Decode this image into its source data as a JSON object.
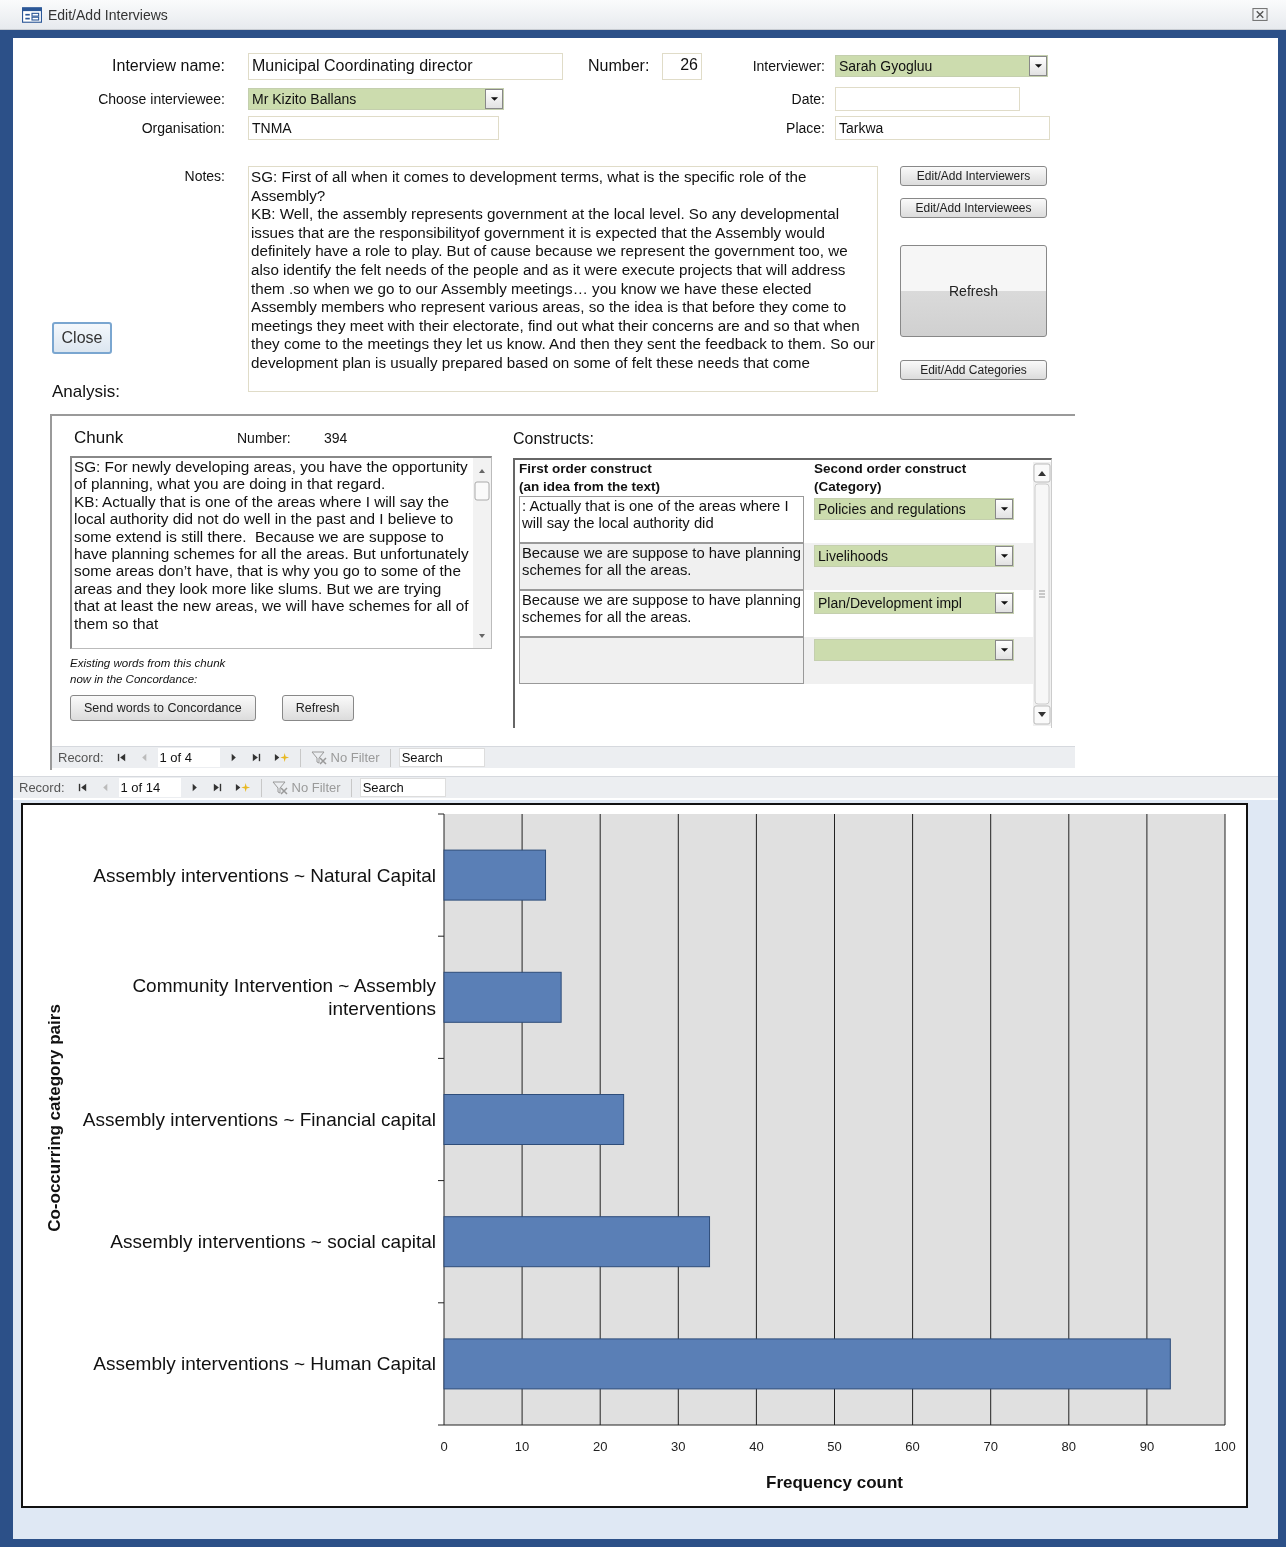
{
  "window": {
    "title": "Edit/Add Interviews"
  },
  "form": {
    "interview_name": {
      "label": "Interview name:",
      "value": "Municipal Coordinating director"
    },
    "number": {
      "label": "Number:",
      "value": "26"
    },
    "interviewer": {
      "label": "Interviewer:",
      "value": "Sarah Gyogluu"
    },
    "interviewee": {
      "label": "Choose interviewee:",
      "value": "Mr Kizito Ballans"
    },
    "date": {
      "label": "Date:"
    },
    "organisation": {
      "label": "Organisation:",
      "value": "TNMA"
    },
    "place": {
      "label": "Place:",
      "value": "Tarkwa"
    },
    "notes": {
      "label": "Notes:",
      "value": "SG: First of all when it comes to development terms, what is the specific role of the Assembly?\nKB: Well, the assembly represents government at the local level. So any developmental issues that are the responsibilityof government it is expected that the Assembly would definitely have a role to play. But of cause because we represent the government too, we also identify the felt needs of the people and as it were execute projects that will address them .so when we go to our Assembly meetings… you know we have these elected Assembly members who represent various areas, so the idea is that before they come to meetings they meet with their electorate, find out what their concerns are and so that when they come to the meetings they let us know. And then they sent the feedback to them. So our development plan is usually prepared based on some of felt these needs that come"
    }
  },
  "side_buttons": [
    {
      "label": "Edit/Add Interviewers",
      "kind": "small"
    },
    {
      "label": "Edit/Add Interviewees",
      "kind": "small"
    },
    {
      "label": "Refresh",
      "kind": "large"
    },
    {
      "label": "Edit/Add Categories",
      "kind": "small"
    }
  ],
  "close_button": "Close",
  "analysis": {
    "label": "Analysis:",
    "chunk": {
      "title": "Chunk",
      "number_label": "Number:",
      "number": "394",
      "text": "SG: For newly developing areas, you have the opportunity of planning, what you are doing in that regard.\nKB: Actually that is one of the areas where I will say the local authority did not do well in the past and I believe to some extend is still there.  Because we are suppose to have planning schemes for all the areas. But unfortunately some areas don’t have, that is why you go to some of the areas and they look more like slums. But we are trying that at least the new areas, we will have schemes for all of them so that",
      "caption": "Existing words from this chunk\nnow in the Concordance:",
      "buttons": [
        "Send words to Concordance",
        "Refresh"
      ]
    },
    "constructs": {
      "title": "Constructs:",
      "columns": [
        "First order construct\n(an idea from the text)",
        "Second order construct\n(Category)"
      ],
      "rows": [
        {
          "first_order": ": Actually that is one of the areas where I will say the local authority did",
          "category": "Policies and regulations"
        },
        {
          "first_order": " Because we are suppose to have planning schemes for all the areas.",
          "category": "Livelihoods"
        },
        {
          "first_order": " Because we are suppose to have planning schemes for all the areas.",
          "category": "Plan/Development  impl"
        },
        {}
      ]
    },
    "navigator": {
      "label": "Record:",
      "position": "1 of 4",
      "filter": "No Filter",
      "search_placeholder": "Search"
    }
  },
  "navigator": {
    "label": "Record:",
    "position": "1 of 14",
    "filter": "No Filter",
    "search_placeholder": "Search"
  },
  "chart": {
    "chart_data": {
      "type": "bar",
      "orientation": "horizontal",
      "xlabel": "Frequency count",
      "ylabel": "Co-occurring category pairs",
      "categories": [
        "Assembly interventions ~ Natural Capital",
        "Community Intervention ~ Assembly interventions",
        "Assembly interventions ~ Financial capital",
        "Assembly interventions ~ social capital",
        "Assembly interventions ~ Human Capital"
      ],
      "series": [
        {
          "color": "#5a7fb6",
          "values": [
            13,
            15,
            23,
            34,
            93
          ]
        }
      ],
      "grid": true,
      "xlim": [
        0,
        100
      ],
      "xticks": [
        0,
        10,
        20,
        30,
        40,
        50,
        60,
        70,
        80,
        90,
        100
      ]
    }
  }
}
